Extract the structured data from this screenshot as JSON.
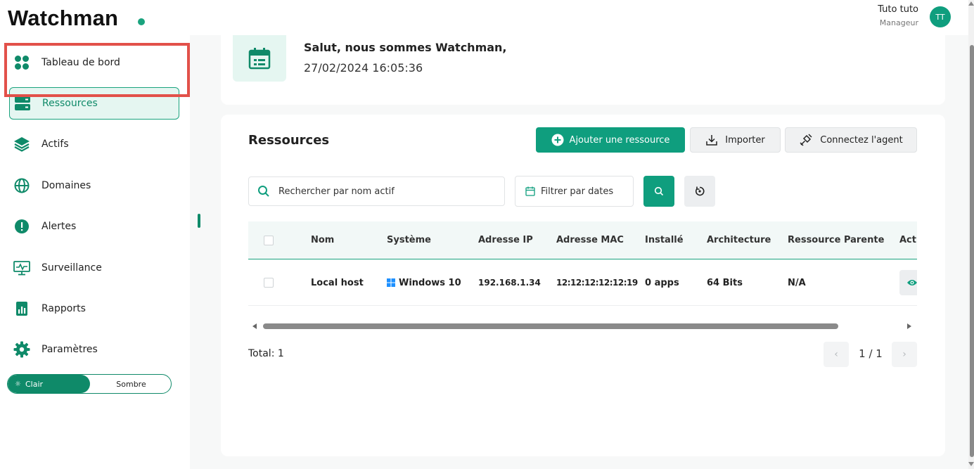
{
  "app": {
    "name": "Watchman",
    "accent": "#0f9e7e",
    "highlight": "#e2514a"
  },
  "user": {
    "name": "Tuto tuto",
    "role": "Manageur",
    "initials": "TT"
  },
  "sidebar": {
    "items": [
      {
        "label": "Tableau de bord",
        "icon": "dashboard-grid-icon"
      },
      {
        "label": "Ressources",
        "icon": "server-icon",
        "active": true
      },
      {
        "label": "Actifs",
        "icon": "layers-icon"
      },
      {
        "label": "Domaines",
        "icon": "globe-icon"
      },
      {
        "label": "Alertes",
        "icon": "alert-icon"
      },
      {
        "label": "Surveillance",
        "icon": "monitor-chart-icon"
      },
      {
        "label": "Rapports",
        "icon": "report-icon"
      },
      {
        "label": "Paramètres",
        "icon": "gear-icon"
      }
    ],
    "theme": {
      "light": "Clair",
      "dark": "Sombre",
      "selected": "Clair"
    }
  },
  "greeting": {
    "title": "Salut, nous sommes Watchman,",
    "datetime": "27/02/2024 16:05:36",
    "icon": "calendar-icon"
  },
  "resources": {
    "title": "Ressources",
    "buttons": {
      "add": "Ajouter une ressource",
      "import": "Importer",
      "connect": "Connectez l'agent"
    },
    "search": {
      "placeholder": "Rechercher par nom actif"
    },
    "date_filter": "Filtrer par dates",
    "table": {
      "columns": [
        "Nom",
        "Système",
        "Adresse IP",
        "Adresse MAC",
        "Installé",
        "Architecture",
        "Ressource Parente",
        "Actions"
      ],
      "rows": [
        {
          "name": "Local host",
          "system": "Windows 10",
          "ip": "192.168.1.34",
          "mac": "12:12:12:12:12:19",
          "installed": "0 apps",
          "architecture": "64 Bits",
          "parent": "N/A"
        }
      ]
    },
    "total": "Total: 1",
    "pagination": {
      "prev": "‹",
      "next": "›",
      "indicator": "1 / 1"
    }
  }
}
